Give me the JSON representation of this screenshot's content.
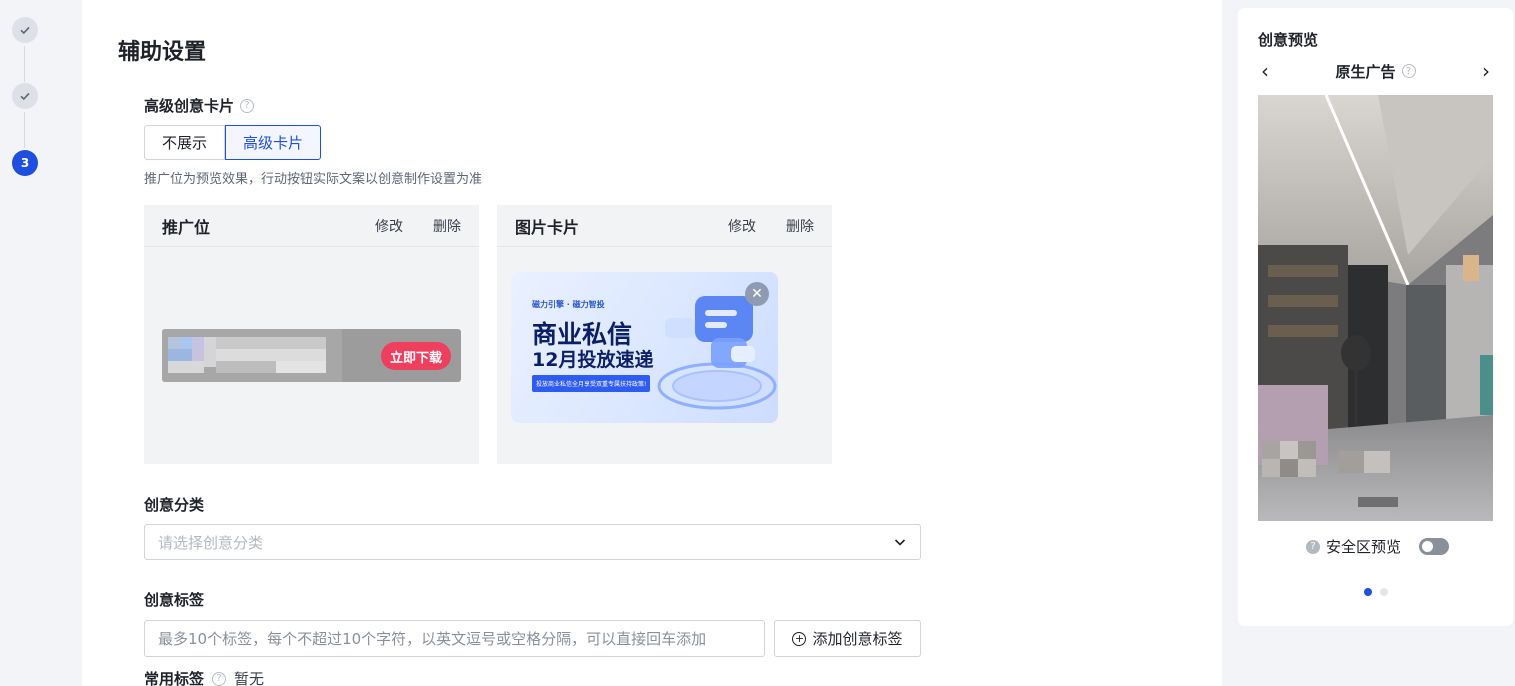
{
  "steps": [
    {
      "state": "done",
      "icon": "check-icon"
    },
    {
      "state": "done",
      "icon": "check-icon"
    },
    {
      "state": "active",
      "number": "3"
    }
  ],
  "page_title": "辅助设置",
  "advanced_card": {
    "label": "高级创意卡片",
    "options": [
      "不展示",
      "高级卡片"
    ],
    "selected": "高级卡片",
    "hint": "推广位为预览效果，行动按钮实际文案以创意制作设置为准"
  },
  "cards": [
    {
      "title": "推广位",
      "edit": "修改",
      "delete": "删除",
      "cta": "立即下载"
    },
    {
      "title": "图片卡片",
      "edit": "修改",
      "delete": "删除",
      "banner": {
        "logo": "磁力引擎 · 磁力智投",
        "headline": "商业私信",
        "subline": "12月投放速递",
        "tag": "投放商业私信全月享受双重专属扶持政策!"
      }
    }
  ],
  "category": {
    "label": "创意分类",
    "placeholder": "请选择创意分类"
  },
  "tags": {
    "label": "创意标签",
    "placeholder": "最多10个标签，每个不超过10个字符，以英文逗号或空格分隔，可以直接回车添加",
    "add_button": "添加创意标签"
  },
  "common_tags": {
    "label": "常用标签",
    "value": "暂无"
  },
  "preview": {
    "title": "创意预览",
    "mode": "原生广告",
    "safe_zone_label": "安全区预览",
    "safe_zone_on": false,
    "page_count": 2,
    "active_page": 1
  },
  "colors": {
    "accent": "#1f4fe0",
    "cta": "#ee3f5f"
  }
}
